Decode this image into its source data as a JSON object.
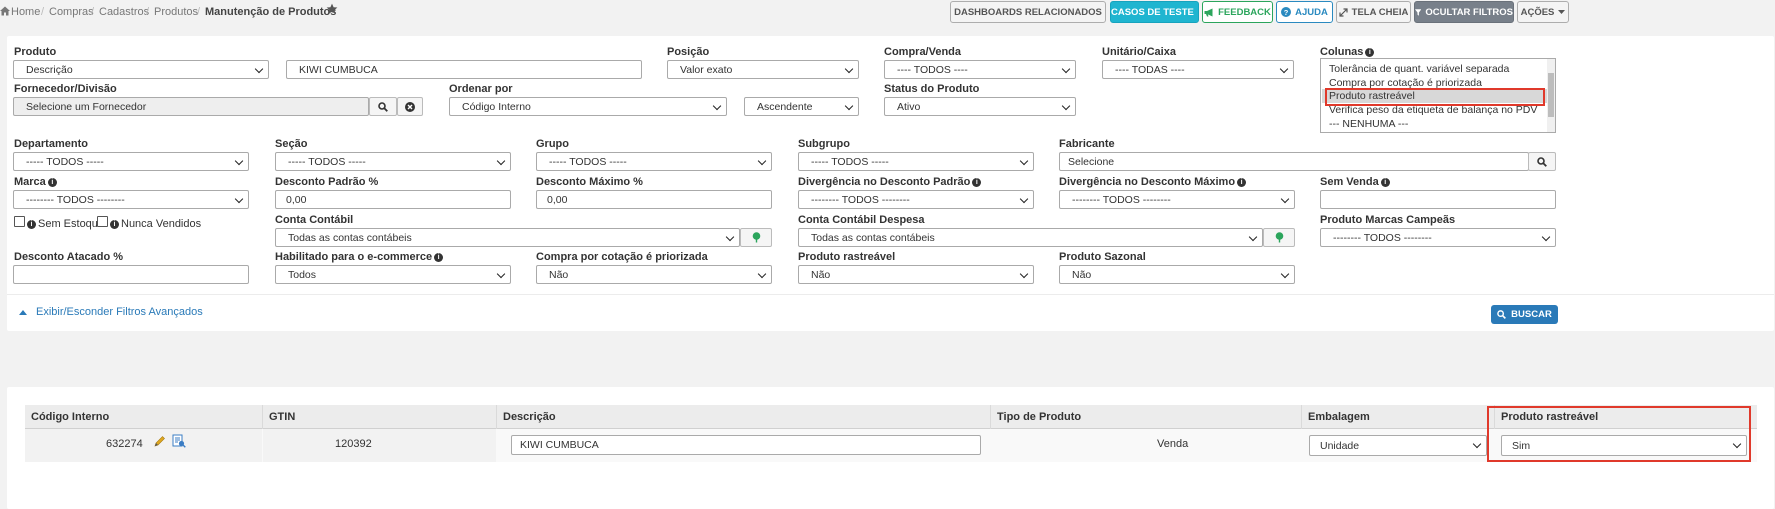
{
  "breadcrumb": {
    "home": "Home",
    "compras": "Compras",
    "cadastros": "Cadastros",
    "produtos": "Produtos",
    "current": "Manutenção de Produtos"
  },
  "toolbar": {
    "dashboards": "DASHBOARDS RELACIONADOS",
    "casos": "CASOS DE TESTE",
    "feedback": "FEEDBACK",
    "ajuda": "AJUDA",
    "tela_cheia": "TELA CHEIA",
    "ocultar": "OCULTAR FILTROS",
    "acoes": "AÇÕES"
  },
  "filters": {
    "produto": {
      "label": "Produto",
      "select": "Descrição",
      "value": "KIWI CUMBUCA"
    },
    "posicao": {
      "label": "Posição",
      "value": "Valor exato"
    },
    "compra_venda": {
      "label": "Compra/Venda",
      "value": "---- TODOS ----"
    },
    "unitario_caixa": {
      "label": "Unitário/Caixa",
      "value": "---- TODAS ----"
    },
    "colunas": {
      "label": "Colunas",
      "options": [
        "Tolerância de quant. variável separada",
        "Compra por cotação é priorizada",
        "Produto rastreável",
        "Verifica peso da etiqueta de balança no PDV",
        "--- NENHUMA ---"
      ],
      "selected_index": 2
    },
    "fornecedor": {
      "label": "Fornecedor/Divisão",
      "placeholder": "Selecione um Fornecedor"
    },
    "ordenar": {
      "label": "Ordenar por",
      "value": "Código Interno",
      "direction": "Ascendente"
    },
    "status": {
      "label": "Status do Produto",
      "value": "Ativo"
    },
    "departamento": {
      "label": "Departamento",
      "value": "----- TODOS -----"
    },
    "secao": {
      "label": "Seção",
      "value": "----- TODOS -----"
    },
    "grupo": {
      "label": "Grupo",
      "value": "----- TODOS -----"
    },
    "subgrupo": {
      "label": "Subgrupo",
      "value": "----- TODOS -----"
    },
    "fabricante": {
      "label": "Fabricante",
      "value": "Selecione"
    },
    "marca": {
      "label": "Marca",
      "value": "-------- TODOS --------"
    },
    "desconto_padrao": {
      "label": "Desconto Padrão %",
      "value": "0,00"
    },
    "desconto_maximo": {
      "label": "Desconto Máximo %",
      "value": "0,00"
    },
    "div_padrao": {
      "label": "Divergência no Desconto Padrão",
      "value": "-------- TODOS --------"
    },
    "div_maximo": {
      "label": "Divergência no Desconto Máximo",
      "value": "-------- TODOS --------"
    },
    "sem_venda": {
      "label": "Sem Venda",
      "value": ""
    },
    "sem_estoque": {
      "label": "Sem Estoque"
    },
    "nunca_vendidos": {
      "label": "Nunca Vendidos"
    },
    "conta_contabil": {
      "label": "Conta Contábil",
      "value": "Todas as contas contábeis"
    },
    "conta_despesa": {
      "label": "Conta Contábil Despesa",
      "value": "Todas as contas contábeis"
    },
    "marcas_campeas": {
      "label": "Produto Marcas Campeãs",
      "value": "-------- TODOS --------"
    },
    "desconto_atacado": {
      "label": "Desconto Atacado %",
      "value": ""
    },
    "ecommerce": {
      "label": "Habilitado para o e-commerce",
      "value": "Todos"
    },
    "cotacao": {
      "label": "Compra por cotação é priorizada",
      "value": "Não"
    },
    "rastreavel": {
      "label": "Produto rastreável",
      "value": "Não"
    },
    "sazonal": {
      "label": "Produto Sazonal",
      "value": "Não"
    },
    "avancados": "Exibir/Esconder Filtros Avançados",
    "buscar": "BUSCAR"
  },
  "table": {
    "headers": [
      "Código Interno",
      "GTIN",
      "Descrição",
      "Tipo de Produto",
      "Embalagem",
      "Produto rastreável"
    ],
    "rows": [
      {
        "codigo": "632274",
        "gtin": "120392",
        "descricao": "KIWI CUMBUCA",
        "tipo": "Venda",
        "embalagem": "Unidade",
        "rastreavel": "Sim"
      }
    ]
  },
  "colors": {
    "accent_red": "#e0392b",
    "primary": "#2a7ab8",
    "cyan": "#1fb5d0",
    "green": "#2ba55c"
  }
}
